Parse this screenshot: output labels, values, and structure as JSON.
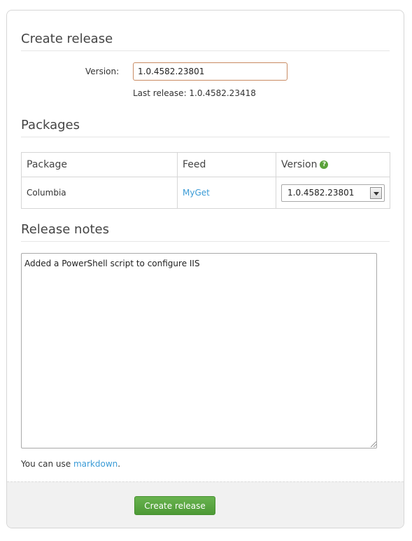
{
  "create_release": {
    "title": "Create release",
    "version_label": "Version:",
    "version_value": "1.0.4582.23801",
    "last_release": "Last release: 1.0.4582.23418"
  },
  "packages": {
    "title": "Packages",
    "columns": [
      "Package",
      "Feed",
      "Version"
    ],
    "rows": [
      {
        "package": "Columbia",
        "feed": "MyGet",
        "version": "1.0.4582.23801"
      }
    ]
  },
  "release_notes": {
    "title": "Release notes",
    "value": "Added a PowerShell script to configure IIS",
    "hint_prefix": "You can use ",
    "hint_link": "markdown",
    "hint_suffix": "."
  },
  "actions": {
    "create_label": "Create release"
  },
  "icons": {
    "version_help": "help-icon"
  },
  "colors": {
    "link": "#3a9bd6",
    "primary_button": "#5aa640",
    "input_focus_border": "#c98b62"
  }
}
